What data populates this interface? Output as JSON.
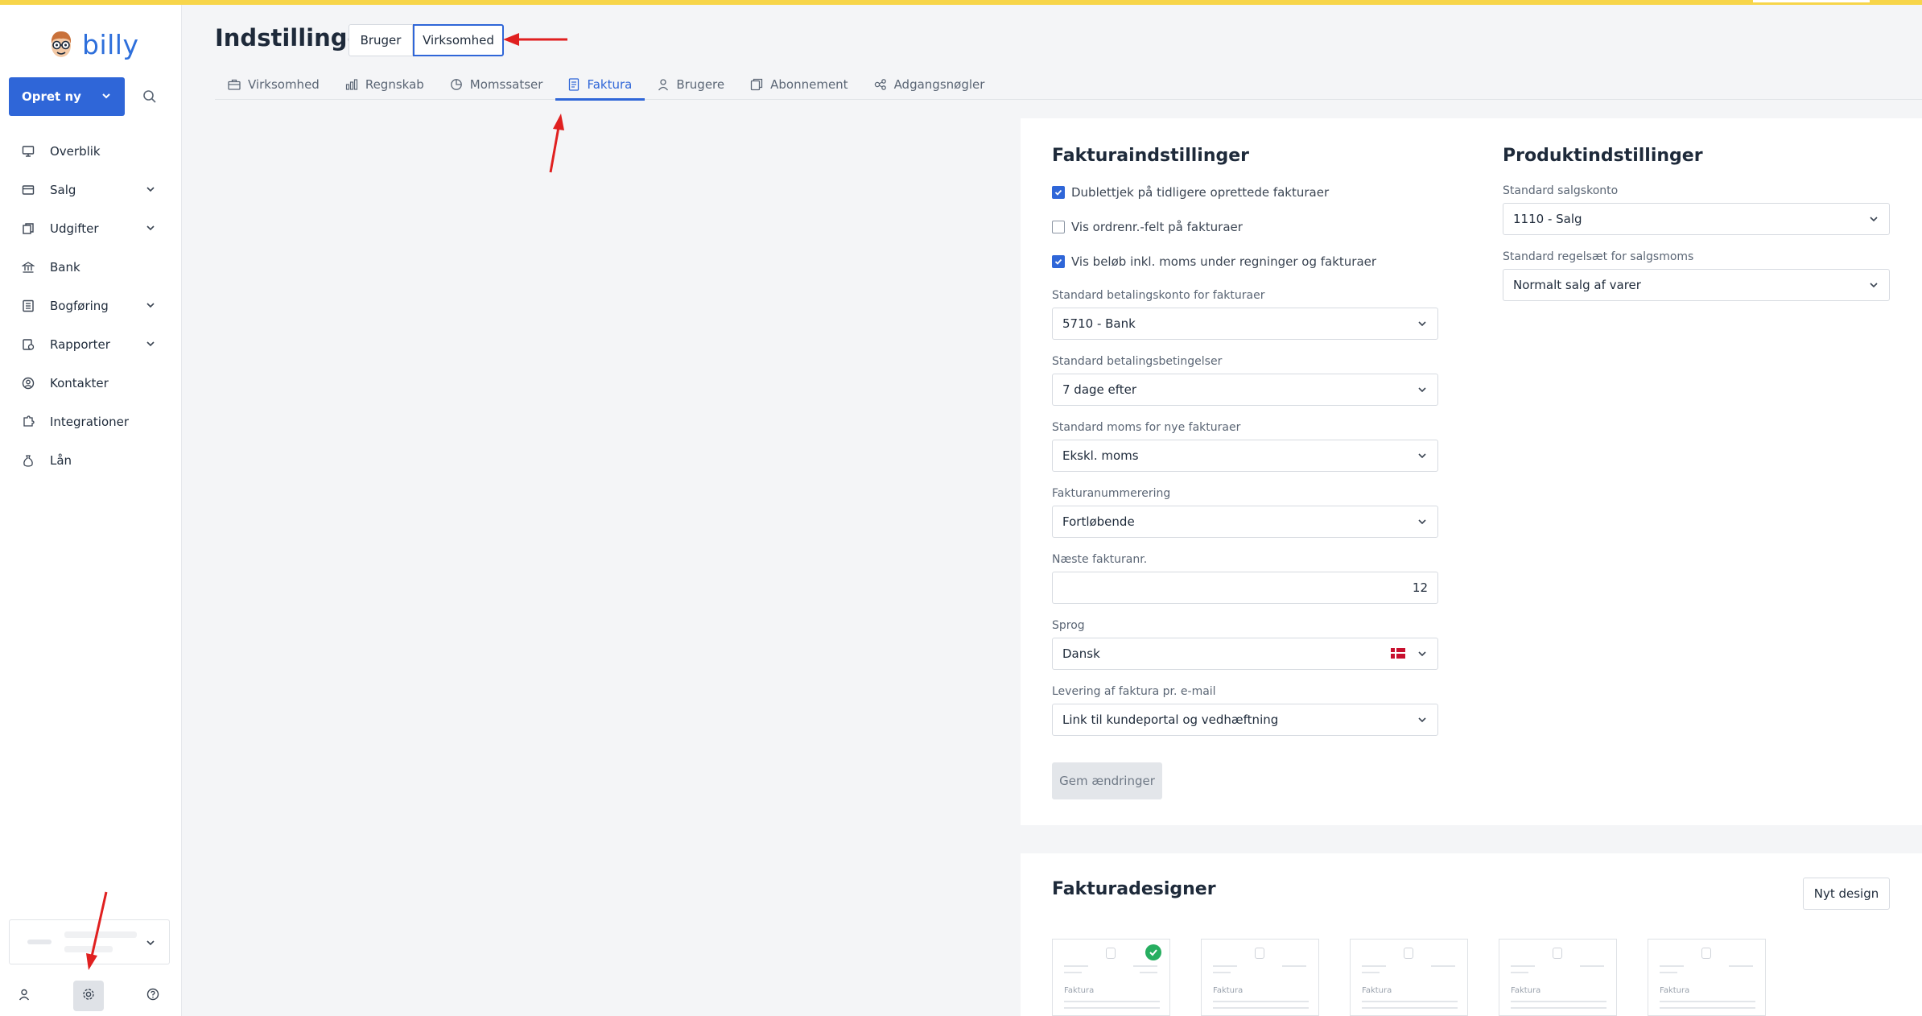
{
  "app": {
    "logo_text": "billy"
  },
  "sidebar": {
    "create_label": "Opret ny",
    "items": [
      {
        "label": "Overblik",
        "icon": "monitor-icon",
        "has_children": false
      },
      {
        "label": "Salg",
        "icon": "tag-icon",
        "has_children": true
      },
      {
        "label": "Udgifter",
        "icon": "receipt-icon",
        "has_children": true
      },
      {
        "label": "Bank",
        "icon": "bank-icon",
        "has_children": false
      },
      {
        "label": "Bogføring",
        "icon": "ledger-icon",
        "has_children": true
      },
      {
        "label": "Rapporter",
        "icon": "report-icon",
        "has_children": true
      },
      {
        "label": "Kontakter",
        "icon": "contact-icon",
        "has_children": false
      },
      {
        "label": "Integrationer",
        "icon": "puzzle-icon",
        "has_children": false
      },
      {
        "label": "Lån",
        "icon": "moneybag-icon",
        "has_children": false
      }
    ]
  },
  "header": {
    "title": "Indstillinger",
    "toggle": {
      "user": "Bruger",
      "company": "Virksomhed",
      "selected": "Virksomhed"
    },
    "tabs": [
      {
        "label": "Virksomhed",
        "icon": "briefcase-icon"
      },
      {
        "label": "Regnskab",
        "icon": "bar-chart-icon"
      },
      {
        "label": "Momssatser",
        "icon": "pie-chart-icon"
      },
      {
        "label": "Faktura",
        "icon": "invoice-icon"
      },
      {
        "label": "Brugere",
        "icon": "user-icon"
      },
      {
        "label": "Abonnement",
        "icon": "subscription-icon"
      },
      {
        "label": "Adgangsnøgler",
        "icon": "key-nodes-icon"
      }
    ],
    "active_tab": "Faktura"
  },
  "invoice_settings": {
    "title": "Fakturaindstillinger",
    "checkboxes": [
      {
        "label": "Dublettjek på tidligere oprettede fakturaer",
        "checked": true
      },
      {
        "label": "Vis ordrenr.-felt på fakturaer",
        "checked": false
      },
      {
        "label": "Vis beløb inkl. moms under regninger og fakturaer",
        "checked": true
      }
    ],
    "payment_account": {
      "label": "Standard betalingskonto for fakturaer",
      "value": "5710 - Bank"
    },
    "payment_terms": {
      "label": "Standard betalingsbetingelser",
      "value": "7 dage efter"
    },
    "default_vat": {
      "label": "Standard moms for nye fakturaer",
      "value": "Ekskl. moms"
    },
    "numbering": {
      "label": "Fakturanummerering",
      "value": "Fortløbende"
    },
    "next_number": {
      "label": "Næste fakturanr.",
      "value": "12"
    },
    "language": {
      "label": "Sprog",
      "value": "Dansk"
    },
    "email_delivery": {
      "label": "Levering af faktura pr. e-mail",
      "value": "Link til kundeportal og vedhæftning"
    },
    "save_label": "Gem ændringer"
  },
  "product_settings": {
    "title": "Produktindstillinger",
    "sales_account": {
      "label": "Standard salgskonto",
      "value": "1110 - Salg"
    },
    "vat_rule": {
      "label": "Standard regelsæt for salgsmoms",
      "value": "Normalt salg af varer"
    }
  },
  "designer": {
    "title": "Fakturadesigner",
    "new_design_label": "Nyt design",
    "thumbnails": [
      {
        "title": "Faktura",
        "selected": true
      },
      {
        "title": "Faktura",
        "selected": false
      },
      {
        "title": "Faktura",
        "selected": false
      },
      {
        "title": "Faktura",
        "selected": false
      },
      {
        "title": "Faktura",
        "selected": false
      }
    ]
  },
  "colors": {
    "accent": "#2f66d8",
    "topbar": "#f7d54a",
    "success": "#27ae60",
    "annotation": "#e02020"
  }
}
